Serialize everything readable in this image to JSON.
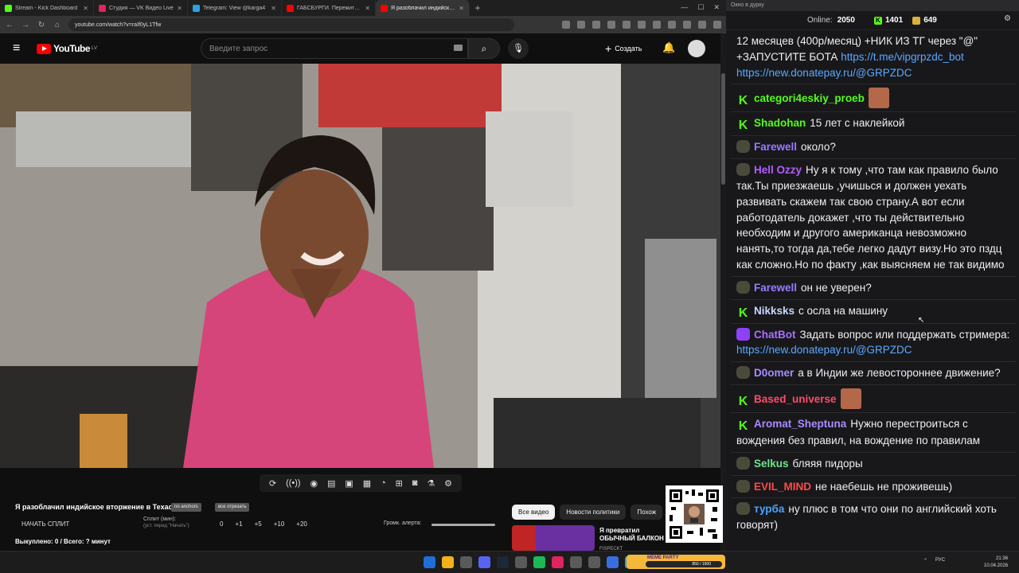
{
  "browser": {
    "tabs": [
      {
        "title": "Stream - Kick Dashboard",
        "color": "#53fc18"
      },
      {
        "title": "Студия — VK Видео Live",
        "color": "#e0245e"
      },
      {
        "title": "Telegram: View @karga4",
        "color": "#2aa3e0"
      },
      {
        "title": "ГАБСБУРГИ. Пережить инцест...",
        "color": "#ff0000"
      },
      {
        "title": "Я разоблачил индийское втор...",
        "color": "#ff0000"
      }
    ],
    "url": "youtube.com/watch?v=raIf0yL1Tfw"
  },
  "youtube": {
    "logo_text": "YouTube",
    "logo_region": "LV",
    "search_placeholder": "Введите запрос",
    "create_label": "Создать"
  },
  "below": {
    "video_title": "Я разоблачил индийское вторжение в Техас...",
    "tag1": "no anchors",
    "tag2": "все отрезать",
    "split_label": "НАЧАТЬ СПЛИТ",
    "split_min_label": "Сплит (мин):",
    "split_min_hint": "(уст. перед \"Начать\")",
    "split_values": [
      "0",
      "+1",
      "+5",
      "+10",
      "+20"
    ],
    "alert_label": "Громк. алерта:",
    "bought_label": "Выкуплено: 0 / Всего: ? минут",
    "chips": [
      "Все видео",
      "Новости политики",
      "Похож"
    ],
    "rec_title": "Я превратил ОБЫЧНЫЙ БАЛКОН В ГЕЙМЕРС...",
    "rec_channel": "FISPECKT"
  },
  "chat": {
    "window_title": "Окно в дурку",
    "online_label": "Online:",
    "online_count": "2050",
    "kick_count": "1401",
    "other_count": "649",
    "messages": [
      {
        "nick": "",
        "color": "#efeff1",
        "badge": "none",
        "text": "12 месяцев (400р/месяц) +НИК ИЗ ТГ через \"@\" +ЗАПУСТИТЕ БОТА ",
        "link": "https://t.me/vipgrpzdc_bot https://new.donatepay.ru/@GRPZDC",
        "emote": false
      },
      {
        "nick": "categori4eskiy_proeb",
        "color": "#53fc18",
        "badge": "k",
        "text": "",
        "link": "",
        "emote": true
      },
      {
        "nick": "Shadohan",
        "color": "#53fc18",
        "badge": "k",
        "text": "15 лет с наклейкой",
        "link": "",
        "emote": false
      },
      {
        "nick": "Farewell",
        "color": "#9a7bff",
        "badge": "d",
        "text": "около?",
        "link": "",
        "emote": false
      },
      {
        "nick": "Hell Ozzy",
        "color": "#b65cff",
        "badge": "d",
        "text": "Ну я к тому ,что там как правило было так.Ты приезжаешь ,учишься и должен уехать развивать скажем так свою страну.А вот если работодатель докажет ,что ты действительно необходим и другого американца невозможно нанять,то тогда да,тебе легко дадут визу.Но это пздц как сложно.Но по факту ,как выясняем не так видимо",
        "link": "",
        "emote": false
      },
      {
        "nick": "Farewell",
        "color": "#9a7bff",
        "badge": "d",
        "text": "он не уверен?",
        "link": "",
        "emote": false
      },
      {
        "nick": "Nikksks",
        "color": "#c8d7ff",
        "badge": "k",
        "text": "с осла на машину",
        "link": "",
        "emote": false
      },
      {
        "nick": "ChatBot",
        "color": "#a970ff",
        "badge": "bot",
        "text": "Задать вопрос или поддержать стримера: ",
        "link": "https://new.donatepay.ru/@GRPZDC",
        "emote": false
      },
      {
        "nick": "D0omer",
        "color": "#a98bff",
        "badge": "d",
        "text": "а в Индии же левостороннее движение?",
        "link": "",
        "emote": false
      },
      {
        "nick": "Based_universe",
        "color": "#ff4a6a",
        "badge": "k",
        "text": "",
        "link": "",
        "emote": true
      },
      {
        "nick": "Aromat_Sheptuna",
        "color": "#a98bff",
        "badge": "k",
        "text": "Нужно перестроиться с вождения без правил, на вождение по правилам",
        "link": "",
        "emote": false
      },
      {
        "nick": "Selkus",
        "color": "#6ee58a",
        "badge": "d",
        "text": "бляяя пидоры",
        "link": "",
        "emote": false
      },
      {
        "nick": "EVIL_MIND",
        "color": "#ff4a4a",
        "badge": "d",
        "text": "не наебешь не проживешь)",
        "link": "",
        "emote": false
      },
      {
        "nick": "турба",
        "color": "#4aa3ff",
        "badge": "d",
        "text": "ну плюс в том что они по английский хоть говорят)",
        "link": "",
        "emote": false
      }
    ]
  },
  "taskbar": {
    "meme_label": "MEME PARTY",
    "meme_progress": "850 / 1500",
    "lang": "РУС",
    "time": "21:36",
    "date": "10.04.2026"
  }
}
